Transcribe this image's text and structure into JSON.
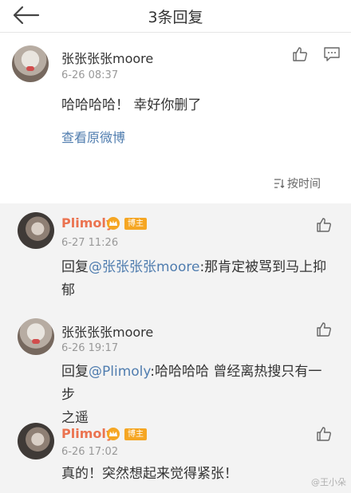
{
  "header": {
    "title": "3条回复"
  },
  "main_comment": {
    "user": "张张张张moore",
    "time": "6-26 08:37",
    "text": "哈哈哈哈！ 幸好你删了",
    "view_original": "查看原微博",
    "sort_label": "按时间"
  },
  "replies": [
    {
      "user": "Plimoly",
      "badge": "博主",
      "time": "6-27 11:26",
      "prefix": "回复",
      "mention": "@张张张张moore",
      "text": ":那肯定被骂到马上抑",
      "text2": "郁"
    },
    {
      "user": "张张张张moore",
      "time": "6-26 19:17",
      "prefix": "回复",
      "mention": "@Plimoly",
      "text": ":哈哈哈哈 曾经离热搜只有一步",
      "text2": "之遥"
    },
    {
      "user": "Plimoly",
      "badge": "博主",
      "time": "6-26 17:02",
      "text": "真的！突然想起来觉得紧张！"
    }
  ],
  "watermark": "@王小朵"
}
